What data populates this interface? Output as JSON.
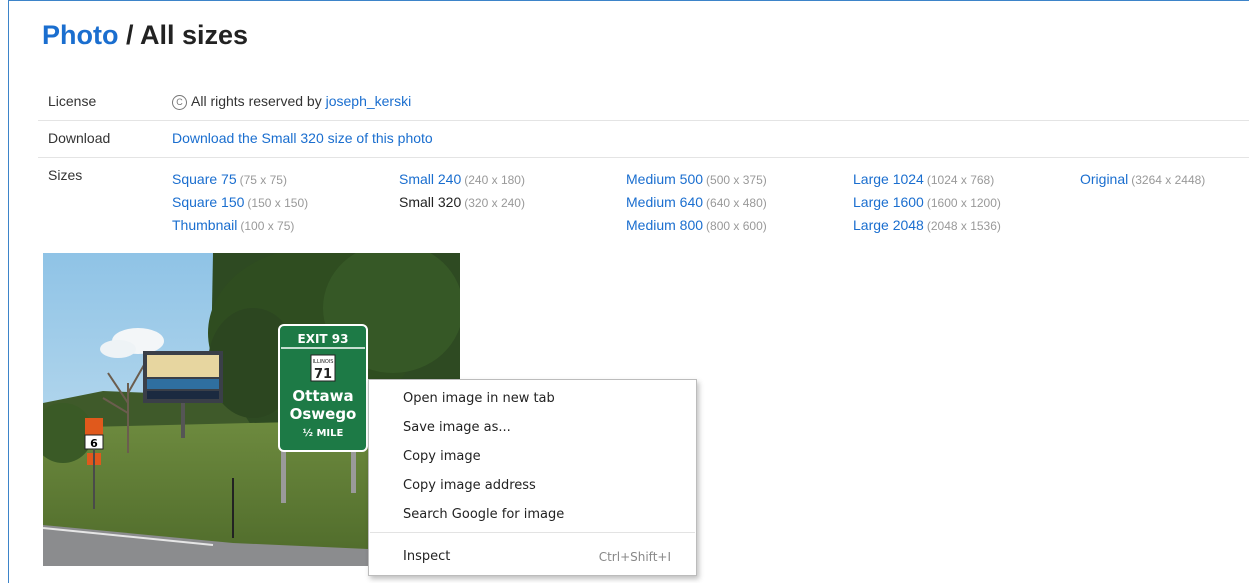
{
  "title": {
    "link": "Photo",
    "sep": " / ",
    "rest": "All sizes"
  },
  "license": {
    "label": "License",
    "icon": "copyright-icon",
    "text": "All rights reserved by ",
    "owner": "joseph_kerski"
  },
  "download": {
    "label": "Download",
    "link": "Download the Small 320 size of this photo"
  },
  "sizes": {
    "label": "Sizes",
    "columns": [
      [
        {
          "name": "Square 75",
          "dim": "(75 x 75)",
          "current": false
        },
        {
          "name": "Square 150",
          "dim": "(150 x 150)",
          "current": false
        },
        {
          "name": "Thumbnail",
          "dim": "(100 x 75)",
          "current": false
        }
      ],
      [
        {
          "name": "Small 240",
          "dim": "(240 x 180)",
          "current": false
        },
        {
          "name": "Small 320",
          "dim": "(320 x 240)",
          "current": true
        }
      ],
      [
        {
          "name": "Medium 500",
          "dim": "(500 x 375)",
          "current": false
        },
        {
          "name": "Medium 640",
          "dim": "(640 x 480)",
          "current": false
        },
        {
          "name": "Medium 800",
          "dim": "(800 x 600)",
          "current": false
        }
      ],
      [
        {
          "name": "Large 1024",
          "dim": "(1024 x 768)",
          "current": false
        },
        {
          "name": "Large 1600",
          "dim": "(1600 x 1200)",
          "current": false
        },
        {
          "name": "Large 2048",
          "dim": "(2048 x 1536)",
          "current": false
        }
      ],
      [
        {
          "name": "Original",
          "dim": "(3264 x 2448)",
          "current": false
        }
      ]
    ]
  },
  "photo": {
    "sign": {
      "exit": "EXIT 93",
      "shield_top": "ILLINOIS",
      "route": "71",
      "line1": "Ottawa",
      "line2": "Oswego",
      "line3": "½ MILE"
    },
    "us_route": "6"
  },
  "context_menu": {
    "items": [
      {
        "label": "Open image in new tab",
        "shortcut": ""
      },
      {
        "label": "Save image as...",
        "shortcut": ""
      },
      {
        "label": "Copy image",
        "shortcut": ""
      },
      {
        "label": "Copy image address",
        "shortcut": ""
      },
      {
        "label": "Search Google for image",
        "shortcut": ""
      }
    ],
    "inspect": {
      "label": "Inspect",
      "shortcut": "Ctrl+Shift+I"
    }
  },
  "colors": {
    "link": "#1a6ecf",
    "frame": "#3d84c9",
    "sign_green": "#1d7a46"
  }
}
